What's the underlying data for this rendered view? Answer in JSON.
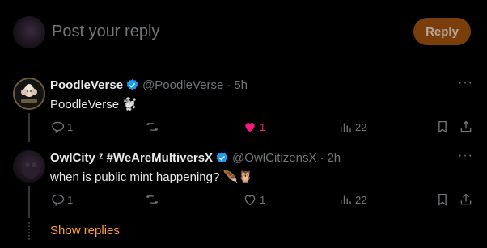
{
  "compose": {
    "placeholder": "Post your reply",
    "button_label": "Reply"
  },
  "tweets": [
    {
      "name": "PoodleVerse",
      "handle": "@PoodleVerse",
      "time": "5h",
      "text": "PoodleVerse 🐩",
      "replies": "1",
      "retweets": "",
      "likes": "1",
      "liked": true,
      "views": "22"
    },
    {
      "name": "OwlCity ᶻ #WeAreMultiversX",
      "handle": "@OwlCitizensX",
      "time": "2h",
      "text": "when is public mint happening? 🪶🦉",
      "replies": "1",
      "retweets": "",
      "likes": "1",
      "liked": false,
      "views": "22"
    }
  ],
  "thread": {
    "show_replies_label": "Show replies"
  },
  "colors": {
    "background": "#000000",
    "accent": "#ff9e2c",
    "verified": "#1d9bf0",
    "like": "#f91880",
    "muted": "#71767b"
  },
  "icons": [
    "reply-icon",
    "retweet-icon",
    "like-icon",
    "views-icon",
    "bookmark-icon",
    "share-icon",
    "verified-badge-icon",
    "more-icon"
  ]
}
